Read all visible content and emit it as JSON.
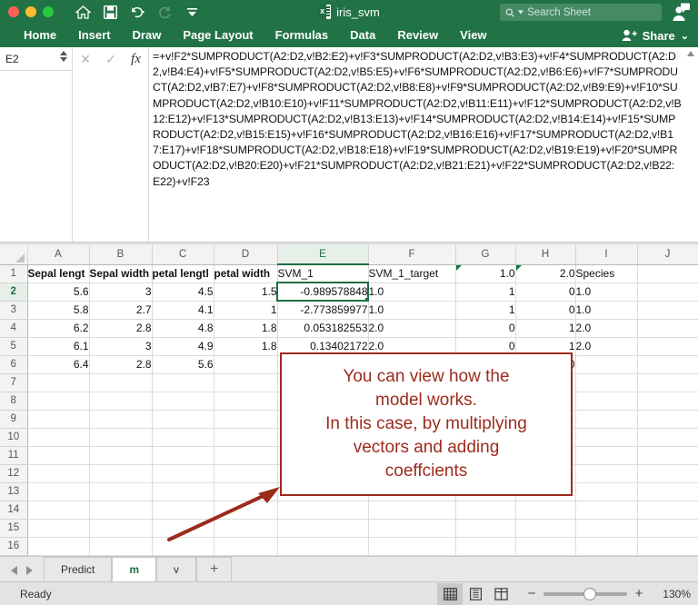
{
  "titlebar": {
    "document_title": "iris_svm",
    "file_icon": "excel-file-icon",
    "quick_access": [
      {
        "name": "home-icon",
        "label": "Home"
      },
      {
        "name": "save-icon",
        "label": "Save"
      },
      {
        "name": "undo-icon",
        "label": "Undo"
      },
      {
        "name": "redo-icon",
        "label": "Redo"
      },
      {
        "name": "customize-toolbar-icon",
        "label": "Customize"
      }
    ],
    "search_placeholder": "Search Sheet",
    "search_value": "",
    "account_icon": "account-icon"
  },
  "ribbon": {
    "tabs": [
      {
        "label": "Home"
      },
      {
        "label": "Insert"
      },
      {
        "label": "Draw"
      },
      {
        "label": "Page Layout"
      },
      {
        "label": "Formulas"
      },
      {
        "label": "Data"
      },
      {
        "label": "Review"
      },
      {
        "label": "View"
      }
    ],
    "active_tab": "Home",
    "share_label": "Share",
    "share_icon": "share-person-icon",
    "share_chevron": "⌄"
  },
  "formula_bar": {
    "name_box_value": "E2",
    "cancel_icon": "✕",
    "confirm_icon": "✓",
    "fx_label": "fx",
    "formula": "=+v!F2*SUMPRODUCT(A2:D2,v!B2:E2)+v!F3*SUMPRODUCT(A2:D2,v!B3:E3)+v!F4*SUMPRODUCT(A2:D2,v!B4:E4)+v!F5*SUMPRODUCT(A2:D2,v!B5:E5)+v!F6*SUMPRODUCT(A2:D2,v!B6:E6)+v!F7*SUMPRODUCT(A2:D2,v!B7:E7)+v!F8*SUMPRODUCT(A2:D2,v!B8:E8)+v!F9*SUMPRODUCT(A2:D2,v!B9:E9)+v!F10*SUMPRODUCT(A2:D2,v!B10:E10)+v!F11*SUMPRODUCT(A2:D2,v!B11:E11)+v!F12*SUMPRODUCT(A2:D2,v!B12:E12)+v!F13*SUMPRODUCT(A2:D2,v!B13:E13)+v!F14*SUMPRODUCT(A2:D2,v!B14:E14)+v!F15*SUMPRODUCT(A2:D2,v!B15:E15)+v!F16*SUMPRODUCT(A2:D2,v!B16:E16)+v!F17*SUMPRODUCT(A2:D2,v!B17:E17)+v!F18*SUMPRODUCT(A2:D2,v!B18:E18)+v!F19*SUMPRODUCT(A2:D2,v!B19:E19)+v!F20*SUMPRODUCT(A2:D2,v!B20:E20)+v!F21*SUMPRODUCT(A2:D2,v!B21:E21)+v!F22*SUMPRODUCT(A2:D2,v!B22:E22)+v!F23"
  },
  "grid": {
    "columns": [
      "A",
      "B",
      "C",
      "D",
      "E",
      "F",
      "G",
      "H",
      "I",
      "J"
    ],
    "selected_column": "E",
    "selected_row": 2,
    "active_cell": "E2",
    "row_numbers": [
      1,
      2,
      3,
      4,
      5,
      6,
      7,
      8,
      9,
      10,
      11,
      12,
      13,
      14,
      15,
      16
    ],
    "rows": [
      {
        "r": 1,
        "cells": [
          {
            "v": "Sepal lengt",
            "a": "left",
            "bold": true
          },
          {
            "v": "Sepal width",
            "a": "left",
            "bold": true
          },
          {
            "v": "petal lengtl",
            "a": "left",
            "bold": true
          },
          {
            "v": "petal width",
            "a": "left",
            "bold": true
          },
          {
            "v": "SVM_1",
            "a": "left",
            "bold": false
          },
          {
            "v": "SVM_1_target",
            "a": "left",
            "bold": false
          },
          {
            "v": "1.0",
            "a": "right",
            "bold": false,
            "marker": true
          },
          {
            "v": "2.0",
            "a": "right",
            "bold": false,
            "marker": true
          },
          {
            "v": "Species",
            "a": "left",
            "bold": false
          },
          {
            "v": "",
            "a": "left",
            "bold": false
          }
        ]
      },
      {
        "r": 2,
        "cells": [
          {
            "v": "5.6",
            "a": "right"
          },
          {
            "v": "3",
            "a": "right"
          },
          {
            "v": "4.5",
            "a": "right"
          },
          {
            "v": "1.5",
            "a": "right"
          },
          {
            "v": "-0.989578848",
            "a": "right",
            "active": true
          },
          {
            "v": "1.0",
            "a": "left"
          },
          {
            "v": "1",
            "a": "right"
          },
          {
            "v": "0",
            "a": "right"
          },
          {
            "v": "1.0",
            "a": "left"
          },
          {
            "v": "",
            "a": "left"
          }
        ]
      },
      {
        "r": 3,
        "cells": [
          {
            "v": "5.8",
            "a": "right"
          },
          {
            "v": "2.7",
            "a": "right"
          },
          {
            "v": "4.1",
            "a": "right"
          },
          {
            "v": "1",
            "a": "right"
          },
          {
            "v": "-2.773859977",
            "a": "right"
          },
          {
            "v": "1.0",
            "a": "left"
          },
          {
            "v": "1",
            "a": "right"
          },
          {
            "v": "0",
            "a": "right"
          },
          {
            "v": "1.0",
            "a": "left"
          },
          {
            "v": "",
            "a": "left"
          }
        ]
      },
      {
        "r": 4,
        "cells": [
          {
            "v": "6.2",
            "a": "right"
          },
          {
            "v": "2.8",
            "a": "right"
          },
          {
            "v": "4.8",
            "a": "right"
          },
          {
            "v": "1.8",
            "a": "right"
          },
          {
            "v": "0.053182553",
            "a": "right"
          },
          {
            "v": "2.0",
            "a": "left"
          },
          {
            "v": "0",
            "a": "right"
          },
          {
            "v": "1",
            "a": "right"
          },
          {
            "v": "2.0",
            "a": "left"
          },
          {
            "v": "",
            "a": "left"
          }
        ]
      },
      {
        "r": 5,
        "cells": [
          {
            "v": "6.1",
            "a": "right"
          },
          {
            "v": "3",
            "a": "right"
          },
          {
            "v": "4.9",
            "a": "right"
          },
          {
            "v": "1.8",
            "a": "right"
          },
          {
            "v": "0.13402172",
            "a": "right"
          },
          {
            "v": "2.0",
            "a": "left"
          },
          {
            "v": "0",
            "a": "right"
          },
          {
            "v": "1",
            "a": "right"
          },
          {
            "v": "2.0",
            "a": "left"
          },
          {
            "v": "",
            "a": "left"
          }
        ]
      },
      {
        "r": 6,
        "cells": [
          {
            "v": "6.4",
            "a": "right"
          },
          {
            "v": "2.8",
            "a": "right"
          },
          {
            "v": "5.6",
            "a": "right"
          },
          {
            "v": "",
            "a": "right"
          },
          {
            "v": "",
            "a": "right"
          },
          {
            "v": "",
            "a": "left"
          },
          {
            "v": "",
            "a": "right"
          },
          {
            "v": "0",
            "a": "right"
          },
          {
            "v": "",
            "a": "left"
          },
          {
            "v": "",
            "a": "left"
          }
        ]
      },
      {
        "r": 7,
        "cells": [
          {
            "v": ""
          },
          {
            "v": ""
          },
          {
            "v": ""
          },
          {
            "v": ""
          },
          {
            "v": ""
          },
          {
            "v": ""
          },
          {
            "v": ""
          },
          {
            "v": ""
          },
          {
            "v": ""
          },
          {
            "v": ""
          }
        ]
      },
      {
        "r": 8,
        "cells": [
          {
            "v": ""
          },
          {
            "v": ""
          },
          {
            "v": ""
          },
          {
            "v": ""
          },
          {
            "v": ""
          },
          {
            "v": ""
          },
          {
            "v": ""
          },
          {
            "v": ""
          },
          {
            "v": ""
          },
          {
            "v": ""
          }
        ]
      },
      {
        "r": 9,
        "cells": [
          {
            "v": ""
          },
          {
            "v": ""
          },
          {
            "v": ""
          },
          {
            "v": ""
          },
          {
            "v": ""
          },
          {
            "v": ""
          },
          {
            "v": ""
          },
          {
            "v": ""
          },
          {
            "v": ""
          },
          {
            "v": ""
          }
        ]
      },
      {
        "r": 10,
        "cells": [
          {
            "v": ""
          },
          {
            "v": ""
          },
          {
            "v": ""
          },
          {
            "v": ""
          },
          {
            "v": ""
          },
          {
            "v": ""
          },
          {
            "v": ""
          },
          {
            "v": ""
          },
          {
            "v": ""
          },
          {
            "v": ""
          }
        ]
      },
      {
        "r": 11,
        "cells": [
          {
            "v": ""
          },
          {
            "v": ""
          },
          {
            "v": ""
          },
          {
            "v": ""
          },
          {
            "v": ""
          },
          {
            "v": ""
          },
          {
            "v": ""
          },
          {
            "v": ""
          },
          {
            "v": ""
          },
          {
            "v": ""
          }
        ]
      },
      {
        "r": 12,
        "cells": [
          {
            "v": ""
          },
          {
            "v": ""
          },
          {
            "v": ""
          },
          {
            "v": ""
          },
          {
            "v": ""
          },
          {
            "v": ""
          },
          {
            "v": ""
          },
          {
            "v": ""
          },
          {
            "v": ""
          },
          {
            "v": ""
          }
        ]
      },
      {
        "r": 13,
        "cells": [
          {
            "v": ""
          },
          {
            "v": ""
          },
          {
            "v": ""
          },
          {
            "v": ""
          },
          {
            "v": ""
          },
          {
            "v": ""
          },
          {
            "v": ""
          },
          {
            "v": ""
          },
          {
            "v": ""
          },
          {
            "v": ""
          }
        ]
      },
      {
        "r": 14,
        "cells": [
          {
            "v": ""
          },
          {
            "v": ""
          },
          {
            "v": ""
          },
          {
            "v": ""
          },
          {
            "v": ""
          },
          {
            "v": ""
          },
          {
            "v": ""
          },
          {
            "v": ""
          },
          {
            "v": ""
          },
          {
            "v": ""
          }
        ]
      },
      {
        "r": 15,
        "cells": [
          {
            "v": ""
          },
          {
            "v": ""
          },
          {
            "v": ""
          },
          {
            "v": ""
          },
          {
            "v": ""
          },
          {
            "v": ""
          },
          {
            "v": ""
          },
          {
            "v": ""
          },
          {
            "v": ""
          },
          {
            "v": ""
          }
        ]
      },
      {
        "r": 16,
        "cells": [
          {
            "v": ""
          },
          {
            "v": ""
          },
          {
            "v": ""
          },
          {
            "v": ""
          },
          {
            "v": ""
          },
          {
            "v": ""
          },
          {
            "v": ""
          },
          {
            "v": ""
          },
          {
            "v": ""
          },
          {
            "v": ""
          }
        ]
      }
    ]
  },
  "annotation": {
    "text": "You can view how the\nmodel works.\nIn this case, by multiplying\nvectors and adding\ncoeffcients",
    "color": "#9c2b1c",
    "arrow": "annotation-arrow"
  },
  "sheet_tabs": {
    "prev_icon": "prev-sheet-icon",
    "next_icon": "next-sheet-icon",
    "tabs": [
      {
        "label": "Predict",
        "active": false
      },
      {
        "label": "m",
        "active": true
      },
      {
        "label": "v",
        "active": false
      }
    ],
    "add_label": "+"
  },
  "status_bar": {
    "status": "Ready",
    "views": [
      {
        "name": "normal-view-icon",
        "active": true
      },
      {
        "name": "page-layout-view-icon",
        "active": false
      },
      {
        "name": "page-break-view-icon",
        "active": false
      }
    ],
    "zoom_out": "−",
    "zoom_in": "+",
    "zoom_level": "130%"
  },
  "theme": {
    "accent_green": "#217346",
    "selection_green": "#1d6f42",
    "annotation_red": "#9c2b1c"
  }
}
